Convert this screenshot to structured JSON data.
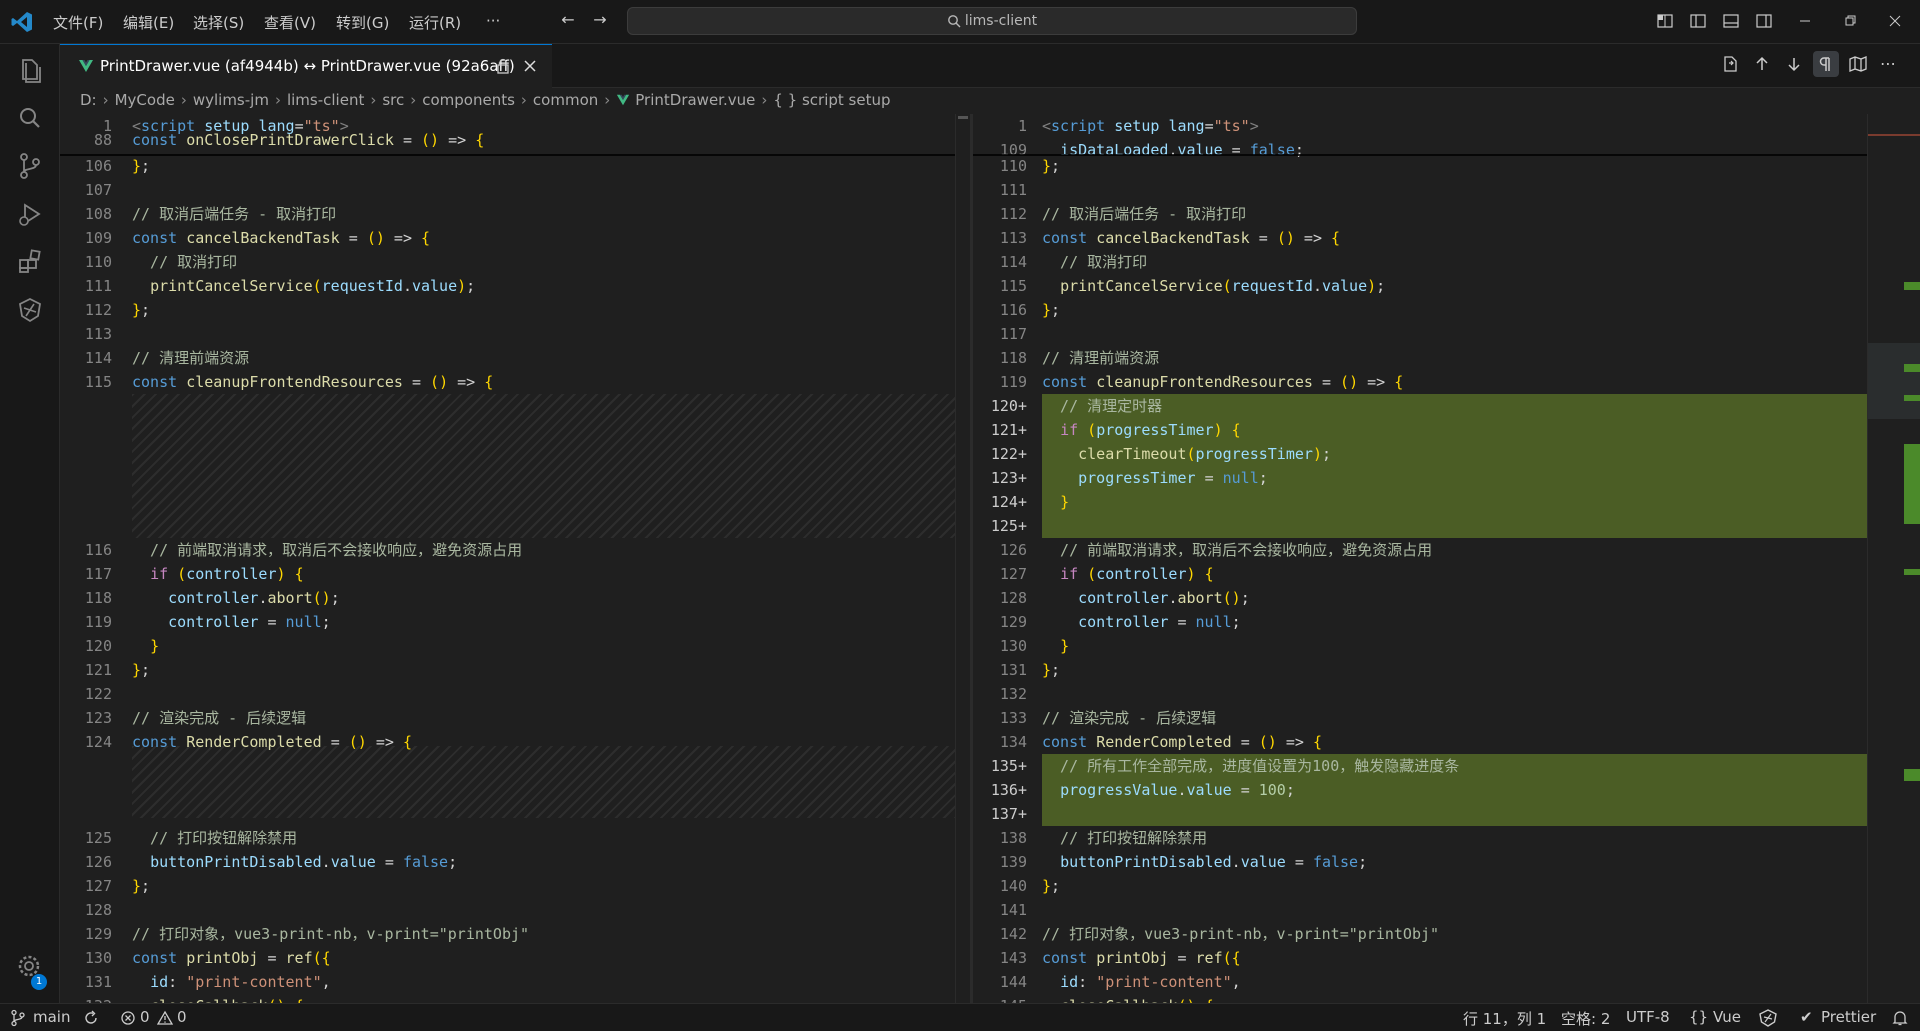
{
  "titlebar": {
    "menus": [
      "文件(F)",
      "编辑(E)",
      "选择(S)",
      "查看(V)",
      "转到(G)",
      "运行(R)",
      "···"
    ],
    "search": "lims-client"
  },
  "tab": {
    "title": "PrintDrawer.vue (af4944b) ↔ PrintDrawer.vue (92a6aff)"
  },
  "breadcrumb": [
    "D:",
    "MyCode",
    "wylims-jm",
    "lims-client",
    "src",
    "components",
    "common",
    "PrintDrawer.vue",
    "{ } script setup"
  ],
  "left_pane": {
    "lines": [
      {
        "n": "1",
        "t": "<script setup lang=\"ts\">"
      },
      {
        "n": "88",
        "t": "const onClosePrintDrawerClick = () => {"
      },
      {
        "n": "106",
        "t": "};"
      },
      {
        "n": "107",
        "t": ""
      },
      {
        "n": "108",
        "t": "// 取消后端任务 - 取消打印"
      },
      {
        "n": "109",
        "t": "const cancelBackendTask = () => {"
      },
      {
        "n": "110",
        "t": "  // 取消打印"
      },
      {
        "n": "111",
        "t": "  printCancelService(requestId.value);"
      },
      {
        "n": "112",
        "t": "};"
      },
      {
        "n": "113",
        "t": ""
      },
      {
        "n": "114",
        "t": "// 清理前端资源"
      },
      {
        "n": "115",
        "t": "const cleanupFrontendResources = () => {"
      },
      {
        "n": "116",
        "t": "  // 前端取消请求，取消后不会接收响应，避免资源占用"
      },
      {
        "n": "117",
        "t": "  if (controller) {"
      },
      {
        "n": "118",
        "t": "    controller.abort();"
      },
      {
        "n": "119",
        "t": "    controller = null;"
      },
      {
        "n": "120",
        "t": "  }"
      },
      {
        "n": "121",
        "t": "};"
      },
      {
        "n": "122",
        "t": ""
      },
      {
        "n": "123",
        "t": "// 渲染完成 - 后续逻辑"
      },
      {
        "n": "124",
        "t": "const RenderCompleted = () => {"
      },
      {
        "n": "125",
        "t": "  // 打印按钮解除禁用"
      },
      {
        "n": "126",
        "t": "  buttonPrintDisabled.value = false;"
      },
      {
        "n": "127",
        "t": "};"
      },
      {
        "n": "128",
        "t": ""
      },
      {
        "n": "129",
        "t": "// 打印对象，vue3-print-nb，v-print=\"printObj\""
      },
      {
        "n": "130",
        "t": "const printObj = ref({"
      },
      {
        "n": "131",
        "t": "  id: \"print-content\","
      },
      {
        "n": "132",
        "t": "  closeCallback() {"
      }
    ]
  },
  "right_pane": {
    "lines": [
      {
        "n": "1",
        "t": "<script setup lang=\"ts\">"
      },
      {
        "n": "109",
        "t": "  isDataLoaded.value = false;"
      },
      {
        "n": "110",
        "t": "};"
      },
      {
        "n": "111",
        "t": ""
      },
      {
        "n": "112",
        "t": "// 取消后端任务 - 取消打印"
      },
      {
        "n": "113",
        "t": "const cancelBackendTask = () => {"
      },
      {
        "n": "114",
        "t": "  // 取消打印"
      },
      {
        "n": "115",
        "t": "  printCancelService(requestId.value);"
      },
      {
        "n": "116",
        "t": "};"
      },
      {
        "n": "117",
        "t": ""
      },
      {
        "n": "118",
        "t": "// 清理前端资源"
      },
      {
        "n": "119",
        "t": "const cleanupFrontendResources = () => {"
      },
      {
        "n": "120+",
        "t": "  // 清理定时器"
      },
      {
        "n": "121+",
        "t": "  if (progressTimer) {"
      },
      {
        "n": "122+",
        "t": "    clearTimeout(progressTimer);"
      },
      {
        "n": "123+",
        "t": "    progressTimer = null;"
      },
      {
        "n": "124+",
        "t": "  }"
      },
      {
        "n": "125+",
        "t": ""
      },
      {
        "n": "126",
        "t": "  // 前端取消请求，取消后不会接收响应，避免资源占用"
      },
      {
        "n": "127",
        "t": "  if (controller) {"
      },
      {
        "n": "128",
        "t": "    controller.abort();"
      },
      {
        "n": "129",
        "t": "    controller = null;"
      },
      {
        "n": "130",
        "t": "  }"
      },
      {
        "n": "131",
        "t": "};"
      },
      {
        "n": "132",
        "t": ""
      },
      {
        "n": "133",
        "t": "// 渲染完成 - 后续逻辑"
      },
      {
        "n": "134",
        "t": "const RenderCompleted = () => {"
      },
      {
        "n": "135+",
        "t": "  // 所有工作全部完成，进度值设置为100，触发隐藏进度条"
      },
      {
        "n": "136+",
        "t": "  progressValue.value = 100;"
      },
      {
        "n": "137+",
        "t": ""
      },
      {
        "n": "138",
        "t": "  // 打印按钮解除禁用"
      },
      {
        "n": "139",
        "t": "  buttonPrintDisabled.value = false;"
      },
      {
        "n": "140",
        "t": "};"
      },
      {
        "n": "141",
        "t": ""
      },
      {
        "n": "142",
        "t": "// 打印对象，vue3-print-nb，v-print=\"printObj\""
      },
      {
        "n": "143",
        "t": "const printObj = ref({"
      },
      {
        "n": "144",
        "t": "  id: \"print-content\","
      },
      {
        "n": "145",
        "t": "  closeCallback() {"
      }
    ]
  },
  "statusbar": {
    "branch": "main",
    "errors": "0",
    "warnings": "0",
    "position": "行 11，列 1",
    "spaces": "空格: 2",
    "encoding": "UTF-8",
    "language": "Vue",
    "formatter": "Prettier",
    "settings_badge": "1"
  },
  "colors": {
    "accent": "#0078d4",
    "added_bg": "#4b5d25",
    "vue_green": "#41b883"
  }
}
